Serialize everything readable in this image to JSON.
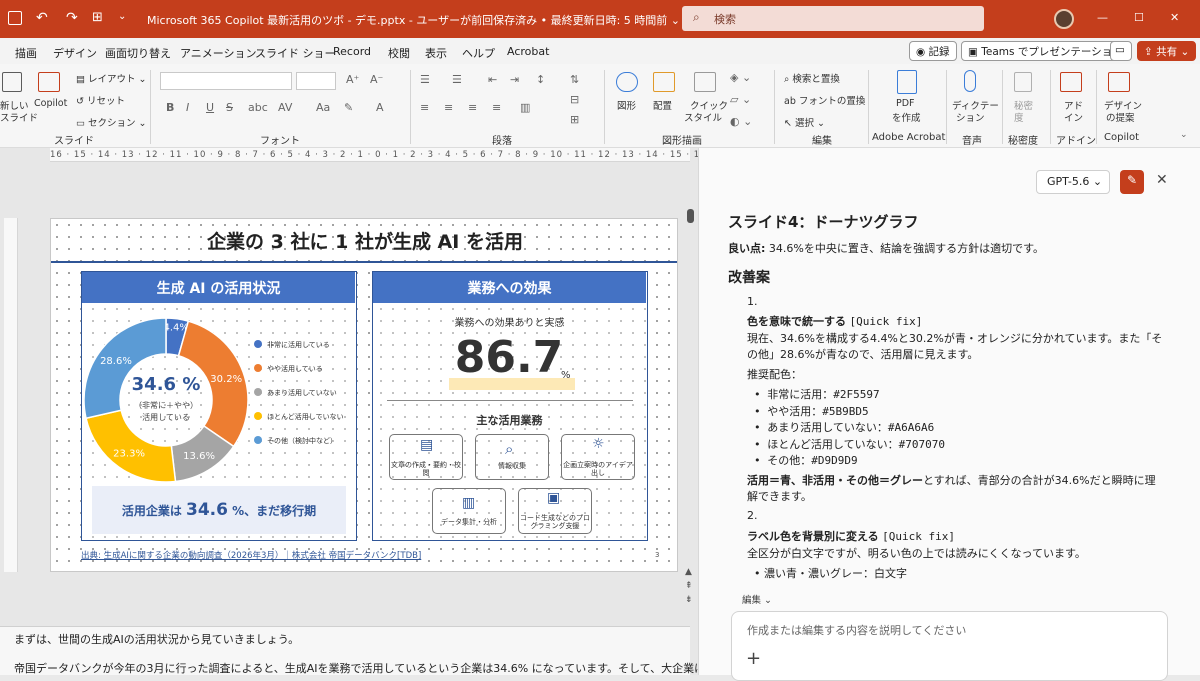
{
  "titlebar": {
    "filename": "Microsoft 365 Copilot 最新活用のツボ - デモ.pptx",
    "save_status": "ユーザーが前回保存済み",
    "updated": "最終更新日時: 5 時間前",
    "search_placeholder": "検索",
    "minimize": "—",
    "restore": "☐",
    "close": "✕"
  },
  "menu": {
    "tabs": [
      "描画",
      "デザイン",
      "画面切り替え",
      "アニメーション",
      "スライド ショー",
      "Record",
      "校閲",
      "表示",
      "ヘルプ",
      "Acrobat"
    ],
    "record": "記録",
    "teams": "Teams でプレゼンテーション",
    "share": "共有"
  },
  "ribbon": {
    "slides": {
      "new": "新しい",
      "new2": "スライド",
      "copilot": "Copilot",
      "layout": "レイアウト",
      "reset": "リセット",
      "section": "セクション",
      "group": "スライド"
    },
    "font": {
      "bold": "B",
      "italic": "I",
      "underline": "U",
      "strike": "S",
      "group": "フォント"
    },
    "para": {
      "group": "段落"
    },
    "drawing": {
      "shape": "図形",
      "arrange": "配置",
      "quickstyle": "クイック",
      "quickstyle2": "スタイル",
      "group": "図形描画"
    },
    "editing": {
      "find": "検索と置換",
      "fontreplace": "フォントの置換",
      "select": "選択",
      "group": "編集"
    },
    "acrobat": {
      "pdf": "PDF",
      "pdf2": "を作成",
      "group": "Adobe Acrobat"
    },
    "voice": {
      "dictate": "ディクテー",
      "dictate2": "ション",
      "group": "音声"
    },
    "sensitivity": {
      "label": "秘密",
      "label2": "度",
      "group": "秘密度"
    },
    "addins": {
      "label": "アド",
      "label2": "イン",
      "group": "アドイン"
    },
    "design": {
      "label": "デザイン",
      "label2": "の提案",
      "group": "Copilot"
    }
  },
  "ruler": "16 · 15 · 14 · 13 · 12 · 11 · 10 · 9 · 8 · 7 · 6 · 5 · 4 · 3 · 2 · 1 · 0 · 1 · 2 · 3 · 4 · 5 · 6 · 7 · 8 · 9 · 10 · 11 · 12 · 13 · 14 · 15 · 16",
  "slide": {
    "title": "企業の 3 社に 1 社が生成 AI を活用",
    "left_header": "生成 AI の活用状況",
    "right_header": "業務への効果",
    "center_big": "34.6 %",
    "center_small1": "（非常に＋やや）",
    "center_small2": "活用している",
    "bottom_note_a": "活用企業は ",
    "bottom_note_b": "34.6",
    "bottom_note_c": " %、まだ移行期",
    "effect_label": "業務への効果ありと実感",
    "effect_value": "86.7",
    "effect_unit": "%",
    "tasks_label": "主な活用業務",
    "tasks": [
      "文章の作成・要約・校閲",
      "情報収集",
      "企画立案時のアイデア出し",
      "データ集計・分析",
      "コード生成などのプログラミング支援"
    ],
    "source": "出典: 生成AIに関する企業の動向調査（2026年3月）｜株式会社 帝国データバンク[TDB]",
    "page_num": "3"
  },
  "chart_data": {
    "type": "pie",
    "donut": true,
    "categories": [
      "非常に活用している",
      "やや活用している",
      "あまり活用していない",
      "ほとんど活用していない",
      "その他（検討中など）"
    ],
    "values": [
      4.4,
      30.2,
      13.6,
      23.3,
      28.6
    ],
    "labels": [
      "4.4%",
      "30.2%",
      "13.6%",
      "23.3%",
      "28.6%"
    ],
    "colors": [
      "#4472c4",
      "#ed7d31",
      "#a5a5a5",
      "#ffc000",
      "#5b9bd5"
    ],
    "legend_position": "right"
  },
  "notes": {
    "line1": "まずは、世間の生成AIの活用状況から見ていきましょう。",
    "line2": "帝国データバンクが今年の3月に行った調査によると、生成AIを業務で活用しているという企業は34.6% になっています。そして、大企業ほど"
  },
  "pane": {
    "model": "GPT-5.6",
    "heading": "スライド4：ドーナツグラフ",
    "good_label": "良い点:",
    "good_text": " 34.6%を中央に置き、結論を強調する方針は適切です。",
    "improve": "改善案",
    "n1": "1.",
    "item1_title": "色を意味で統一する",
    "item1_tag": "[Quick fix]",
    "item1_p1": "現在、34.6%を構成する4.4%と30.2%が青・オレンジに分かれています。また「そ",
    "item1_p2": "の他」28.6%が青なので、活用層に見えます。",
    "rec": "推奨配色：",
    "colors": [
      "非常に活用：#2F5597",
      "やや活用：#5B9BD5",
      "あまり活用していない：#A6A6A6",
      "ほとんど活用していない：#707070",
      "その他：#D9D9D9"
    ],
    "summary_bold": "活用＝青、非活用・その他＝グレー",
    "summary_a": "とすれば、青部分の合計が34.6%だと瞬時に理",
    "summary_b": "解できます。",
    "n2": "2.",
    "item2_title": "ラベル色を背景別に変える",
    "item2_tag": "[Quick fix]",
    "item2_p1": "全区分が白文字ですが、明るい色の上では読みにくくなっています。",
    "item2_bullet": "濃い青・濃いグレー：白文字",
    "edit_label": "編集",
    "input_placeholder": "作成または編集する内容を説明してください",
    "plus": "+"
  }
}
